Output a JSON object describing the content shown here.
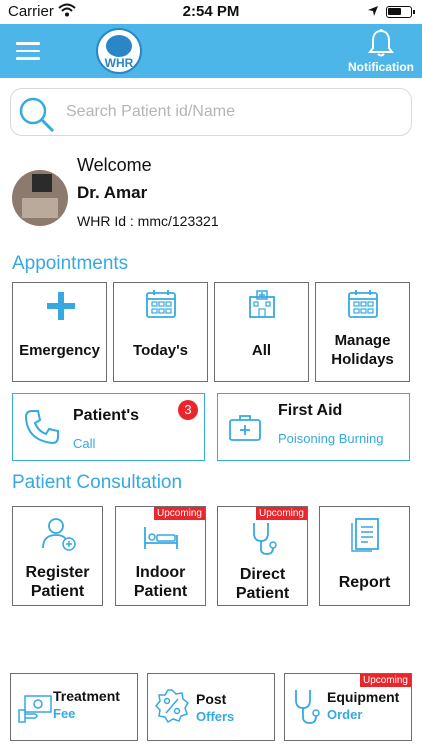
{
  "status_bar": {
    "carrier": "Carrier",
    "time": "2:54 PM"
  },
  "header": {
    "logo_text": "WHR",
    "notification_label": "Notification"
  },
  "search": {
    "placeholder": "Search Patient id/Name"
  },
  "profile": {
    "welcome": "Welcome",
    "name": "Dr. Amar",
    "whr_id": "WHR Id : mmc/123321"
  },
  "appointments": {
    "title": "Appointments",
    "tiles": [
      {
        "label": "Emergency"
      },
      {
        "label": "Today's"
      },
      {
        "label": "All"
      },
      {
        "label": "Manage Holidays"
      }
    ],
    "patients_call": {
      "title": "Patient's",
      "subtitle": "Call",
      "badge": "3"
    },
    "first_aid": {
      "title": "First Aid",
      "subtitle": "Poisoning Burning"
    }
  },
  "consultation": {
    "title": "Patient Consultation",
    "tiles": [
      {
        "label": "Register Patient",
        "tag": ""
      },
      {
        "label": "Indoor Patient",
        "tag": "Upcoming"
      },
      {
        "label": "Direct Patient",
        "tag": "Upcoming"
      },
      {
        "label": "Report",
        "tag": ""
      }
    ]
  },
  "bottom_buttons": [
    {
      "line1": "Treatment",
      "line2": "Fee",
      "tag": ""
    },
    {
      "line1": "Post",
      "line2": "Offers",
      "tag": ""
    },
    {
      "line1": "Equipment",
      "line2": "Order",
      "tag": "Upcoming"
    }
  ],
  "colors": {
    "header": "#4db6e8",
    "accent": "#36a9e1",
    "badge": "#e8262c"
  }
}
